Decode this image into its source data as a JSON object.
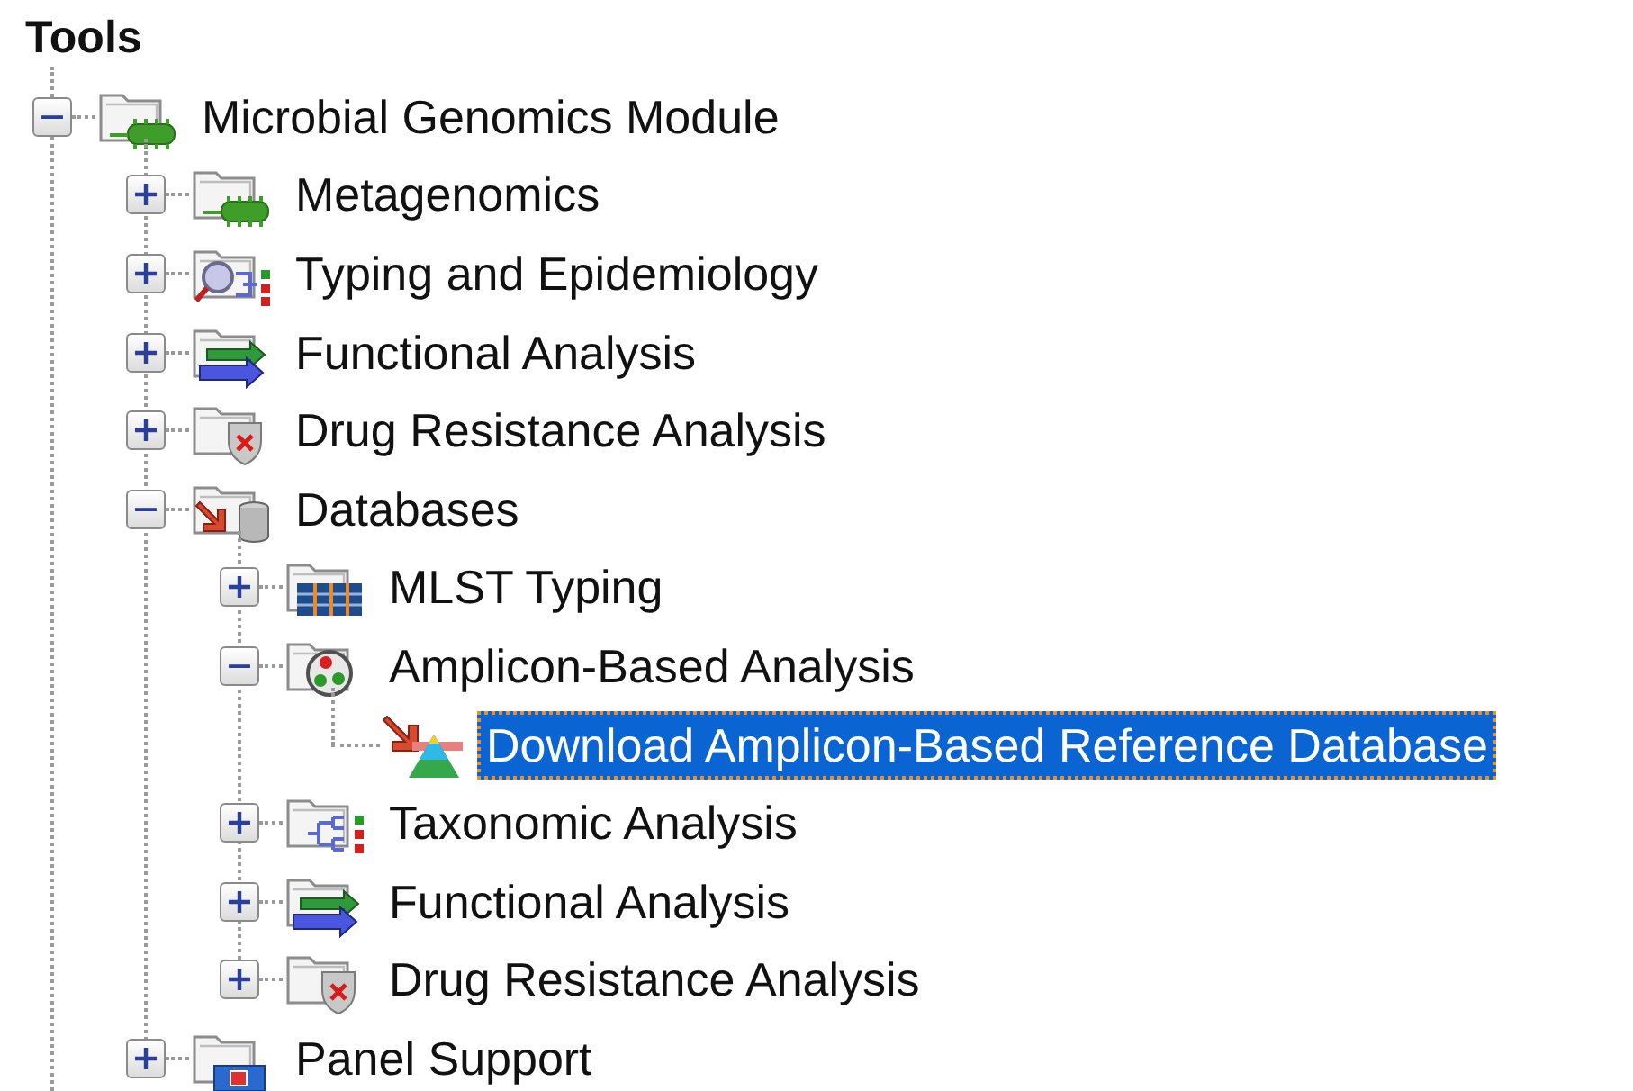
{
  "panel": {
    "title": "Tools"
  },
  "tree": [
    {
      "label": "Microbial Genomics Module",
      "kind": "bacteria",
      "expanded": true,
      "selected": false,
      "children": [
        {
          "label": "Metagenomics",
          "kind": "bacteria",
          "expanded": false,
          "selected": false
        },
        {
          "label": "Typing and Epidemiology",
          "kind": "typing",
          "expanded": false,
          "selected": false
        },
        {
          "label": "Functional Analysis",
          "kind": "functional",
          "expanded": false,
          "selected": false
        },
        {
          "label": "Drug Resistance Analysis",
          "kind": "resistance",
          "expanded": false,
          "selected": false
        },
        {
          "label": "Databases",
          "kind": "database",
          "expanded": true,
          "selected": false,
          "children": [
            {
              "label": "MLST Typing",
              "kind": "mlst",
              "expanded": false,
              "selected": false
            },
            {
              "label": "Amplicon-Based Analysis",
              "kind": "amplicon",
              "expanded": true,
              "selected": false,
              "children": [
                {
                  "label": "Download Amplicon-Based Reference Database",
                  "kind": "download",
                  "selected": true
                }
              ]
            },
            {
              "label": "Taxonomic Analysis",
              "kind": "taxonomy",
              "expanded": false,
              "selected": false
            },
            {
              "label": "Functional Analysis",
              "kind": "functional",
              "expanded": false,
              "selected": false
            },
            {
              "label": "Drug Resistance Analysis",
              "kind": "resistance",
              "expanded": false,
              "selected": false
            }
          ]
        },
        {
          "label": "Panel Support",
          "kind": "panel",
          "expanded": false,
          "selected": false
        }
      ]
    }
  ]
}
